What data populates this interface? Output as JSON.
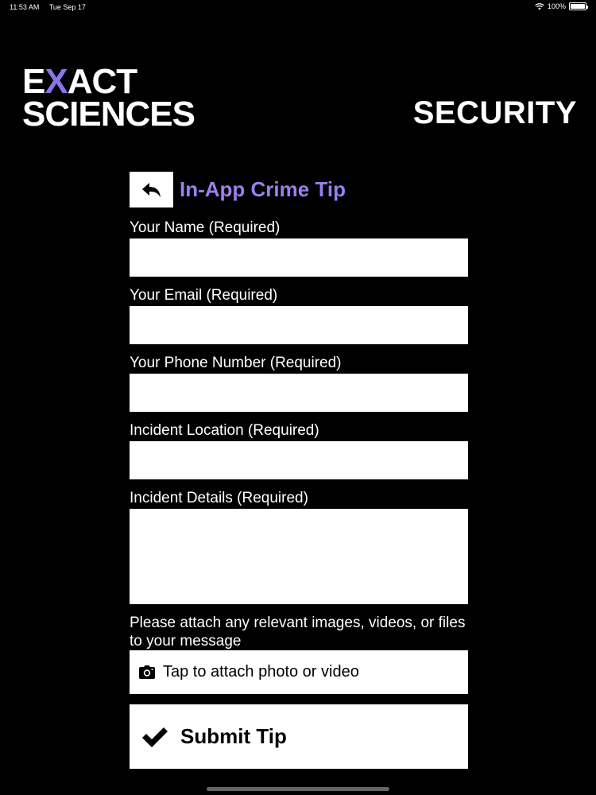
{
  "status_bar": {
    "time": "11:53 AM",
    "date": "Tue Sep 17",
    "battery": "100%",
    "battery_level": 1.0,
    "wifi_icon": "wifi-icon"
  },
  "brand": {
    "line1_pre": "E",
    "line1_x": "X",
    "line1_post": "ACT",
    "line2": "SCIENCES",
    "accent_color": "#8b73e8"
  },
  "security_label": "SECURITY",
  "header": {
    "back_icon": "back-arrow-icon",
    "title": "In-App Crime Tip",
    "title_color": "#9b7ff0"
  },
  "form": {
    "name_label": "Your Name (Required)",
    "name_value": "",
    "email_label": "Your Email (Required)",
    "email_value": "",
    "phone_label": "Your Phone Number (Required)",
    "phone_value": "",
    "location_label": "Incident Location (Required)",
    "location_value": "",
    "details_label": "Incident Details (Required)",
    "details_value": ""
  },
  "attach": {
    "note": "Please attach any relevant images, videos, or files to your message",
    "button_label": "Tap to attach photo or video",
    "icon": "camera-icon"
  },
  "submit": {
    "label": "Submit Tip",
    "icon": "checkmark-icon"
  }
}
